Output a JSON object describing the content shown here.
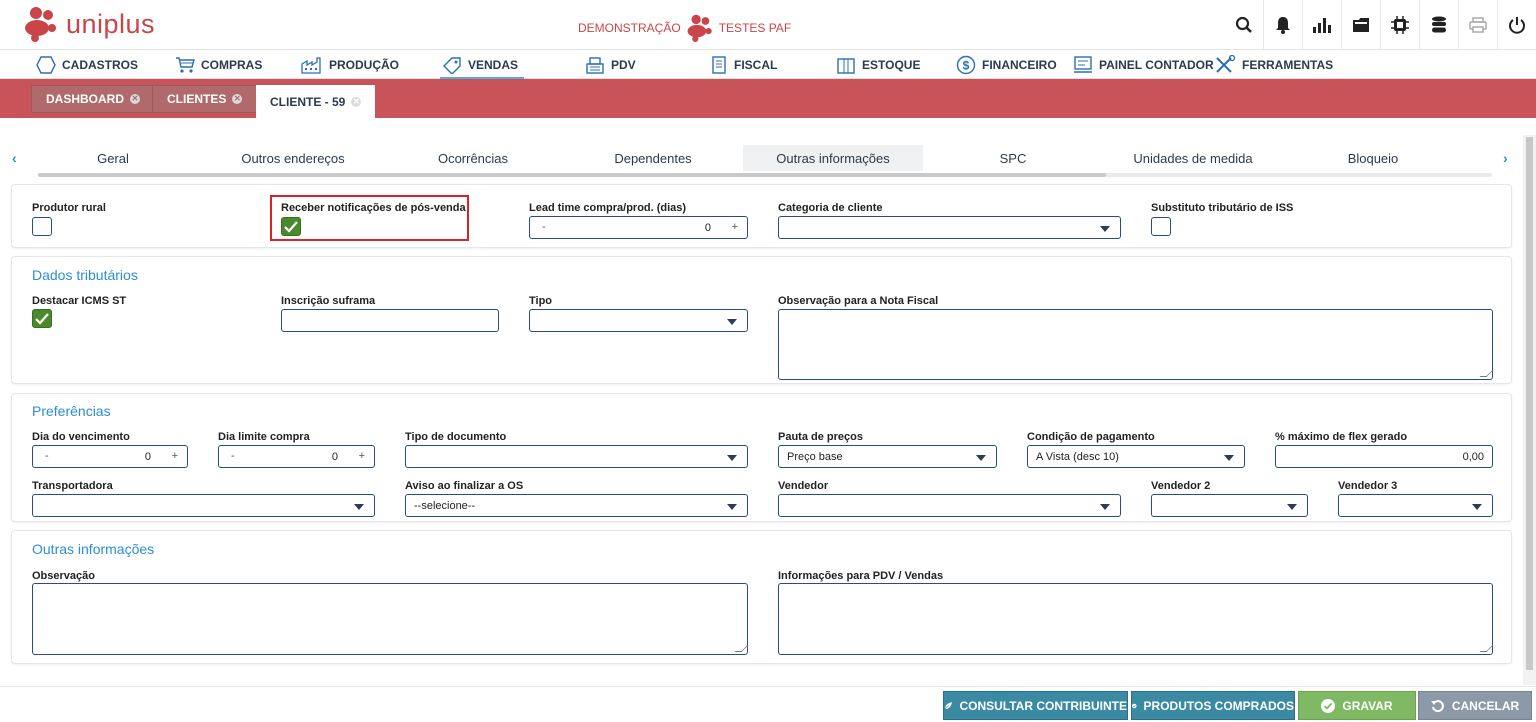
{
  "app": {
    "logo_text": "uniplus",
    "demo_label": "DEMONSTRAÇÃO",
    "company_label": "TESTES PAF",
    "brand_color": "#c9454a",
    "accent_color": "#2b8fd3"
  },
  "top_icons": [
    "search-icon",
    "bell-icon",
    "chart-icon",
    "folder-icon",
    "chip-icon",
    "database-icon",
    "printer-icon",
    "power-icon"
  ],
  "menu": {
    "items": [
      {
        "label": "CADASTROS",
        "icon": "hexagon-icon"
      },
      {
        "label": "COMPRAS",
        "icon": "cart-icon"
      },
      {
        "label": "PRODUÇÃO",
        "icon": "factory-icon"
      },
      {
        "label": "VENDAS",
        "icon": "tag-icon",
        "active": true
      },
      {
        "label": "PDV",
        "icon": "register-icon"
      },
      {
        "label": "FISCAL",
        "icon": "document-icon"
      },
      {
        "label": "ESTOQUE",
        "icon": "box-icon"
      },
      {
        "label": "FINANCEIRO",
        "icon": "dollar-icon"
      },
      {
        "label": "PAINEL CONTADOR",
        "icon": "panel-icon"
      },
      {
        "label": "FERRAMENTAS",
        "icon": "tools-icon"
      }
    ]
  },
  "tabs": [
    {
      "label": "DASHBOARD"
    },
    {
      "label": "CLIENTES"
    },
    {
      "label": "CLIENTE - 59",
      "active": true
    }
  ],
  "subtabs": [
    {
      "label": "Geral"
    },
    {
      "label": "Outros endereços"
    },
    {
      "label": "Ocorrências"
    },
    {
      "label": "Dependentes"
    },
    {
      "label": "Outras informações",
      "active": true
    },
    {
      "label": "SPC"
    },
    {
      "label": "Unidades de medida"
    },
    {
      "label": "Bloqueio"
    }
  ],
  "general": {
    "produtor_rural_label": "Produtor rural",
    "produtor_rural_checked": false,
    "receber_notif_label": "Receber notificações de pós-venda",
    "receber_notif_checked": true,
    "lead_time_label": "Lead time compra/prod. (dias)",
    "lead_time_value": "0",
    "categoria_label": "Categoria de cliente",
    "categoria_value": "",
    "substituto_label": "Substituto tributário de ISS",
    "substituto_checked": false
  },
  "tributarios": {
    "title": "Dados tributários",
    "destacar_label": "Destacar ICMS ST",
    "destacar_checked": true,
    "suframa_label": "Inscrição suframa",
    "suframa_value": "",
    "tipo_label": "Tipo",
    "tipo_value": "",
    "obs_nf_label": "Observação para a Nota Fiscal",
    "obs_nf_value": ""
  },
  "preferencias": {
    "title": "Preferências",
    "dia_venc_label": "Dia do vencimento",
    "dia_venc_value": "0",
    "dia_limite_label": "Dia limite compra",
    "dia_limite_value": "0",
    "tipo_doc_label": "Tipo de documento",
    "tipo_doc_value": "",
    "pauta_label": "Pauta de preços",
    "pauta_value": "Preço base",
    "condicao_label": "Condição de pagamento",
    "condicao_value": "A Vista (desc 10)",
    "flex_label": "% máximo de flex gerado",
    "flex_value": "0,00",
    "transportadora_label": "Transportadora",
    "transportadora_value": "",
    "aviso_label": "Aviso ao finalizar a OS",
    "aviso_value": "--selecione--",
    "vendedor_label": "Vendedor",
    "vendedor_value": "",
    "vendedor2_label": "Vendedor 2",
    "vendedor2_value": "",
    "vendedor3_label": "Vendedor 3",
    "vendedor3_value": ""
  },
  "outras": {
    "title": "Outras informações",
    "obs_label": "Observação",
    "obs_value": "",
    "info_pdv_label": "Informações para PDV / Vendas",
    "info_pdv_value": ""
  },
  "footer": {
    "consultar_label": "CONSULTAR CONTRIBUINTE",
    "produtos_label": "PRODUTOS COMPRADOS",
    "gravar_label": "GRAVAR",
    "cancelar_label": "CANCELAR"
  }
}
